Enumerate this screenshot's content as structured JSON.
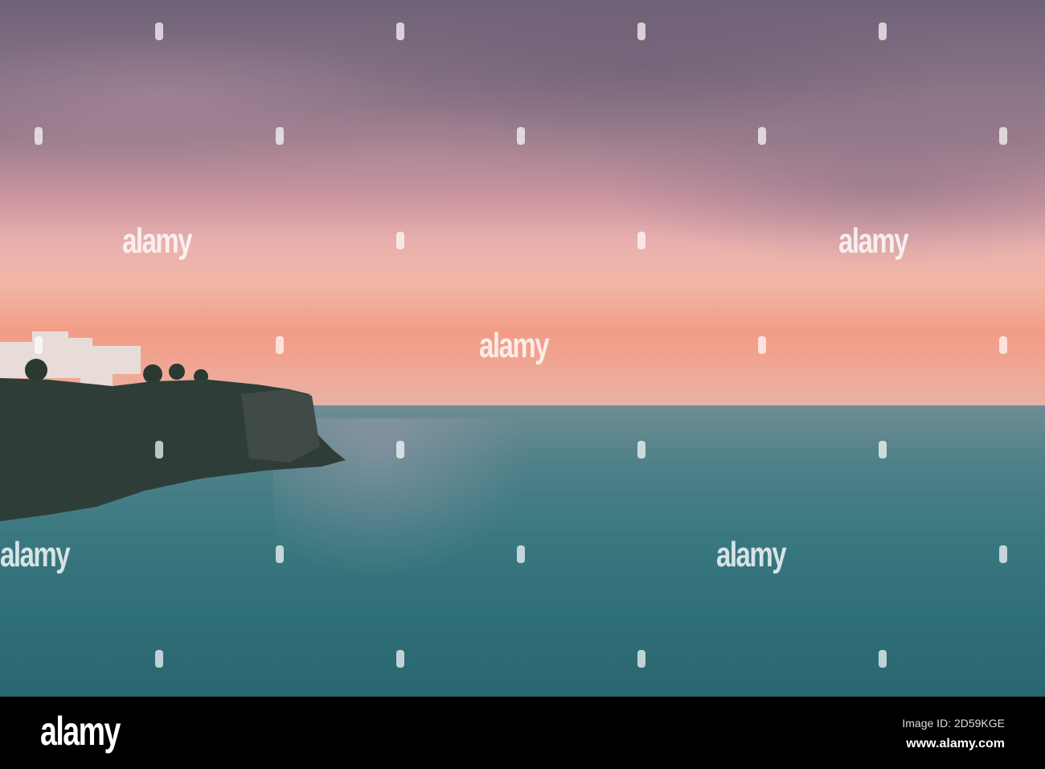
{
  "watermark": {
    "text": "alamy"
  },
  "footer": {
    "logo": "alamy",
    "image_id": "Image ID: 2D59KGE",
    "url": "www.alamy.com"
  }
}
